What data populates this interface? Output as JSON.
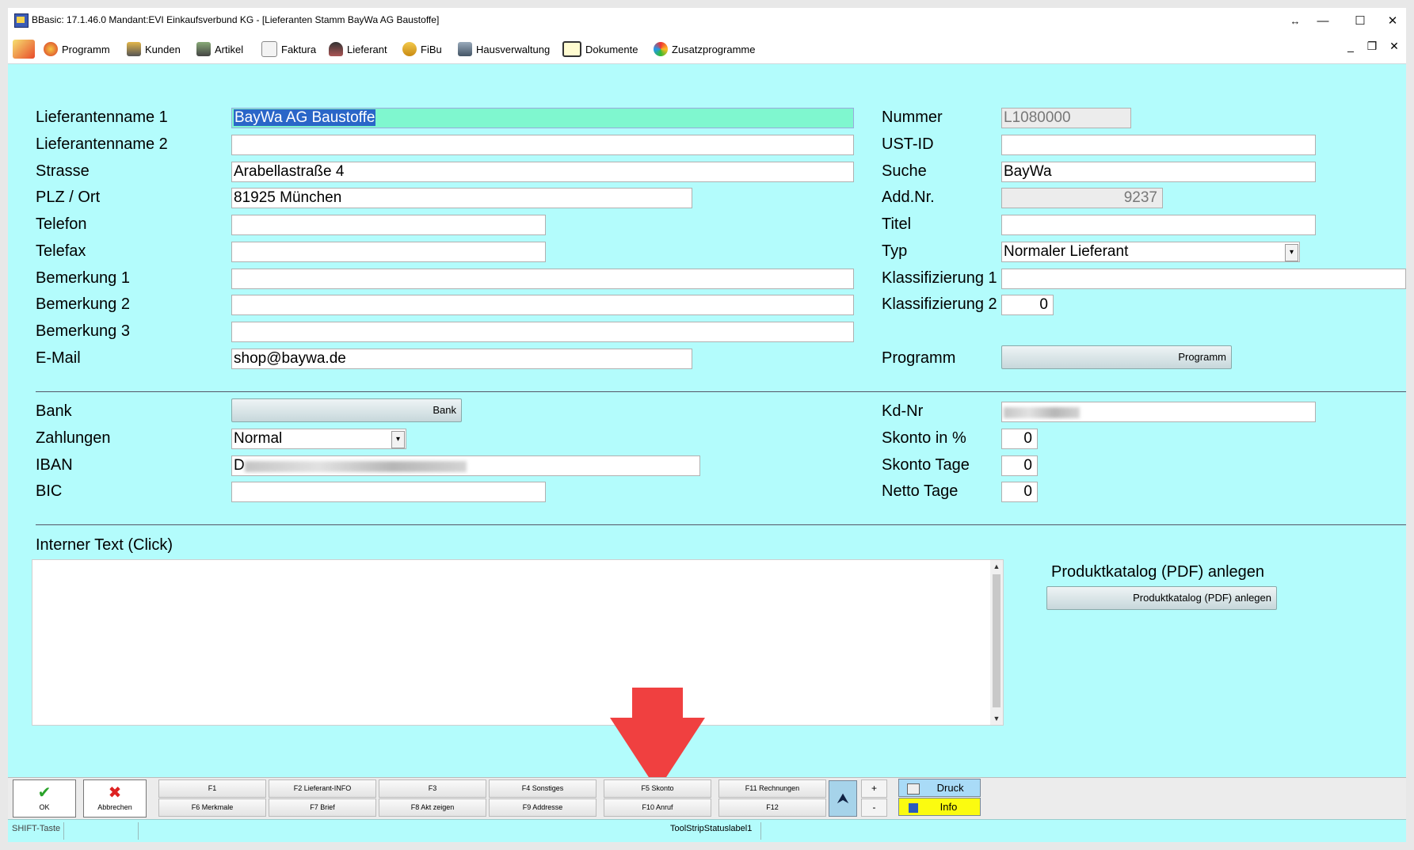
{
  "window": {
    "title": "BBasic: 17.1.46.0 Mandant:EVI Einkaufsverbund KG  - [Lieferanten Stamm BayWa AG Baustoffe]",
    "controls": {
      "resize": "↔",
      "minimize": "—",
      "maximize": "☐",
      "close": "✕"
    }
  },
  "menu": {
    "items": [
      {
        "label": "Programm",
        "icon": "program-icon"
      },
      {
        "label": "Kunden",
        "icon": "customers-icon"
      },
      {
        "label": "Artikel",
        "icon": "articles-icon"
      },
      {
        "label": "Faktura",
        "icon": "invoice-icon"
      },
      {
        "label": "Lieferant",
        "icon": "supplier-icon"
      },
      {
        "label": "FiBu",
        "icon": "accounting-icon"
      },
      {
        "label": "Hausverwaltung",
        "icon": "property-icon"
      },
      {
        "label": "Dokumente",
        "icon": "documents-icon"
      },
      {
        "label": "Zusatzprogramme",
        "icon": "addons-icon"
      }
    ],
    "mdi": {
      "minimize": "_",
      "restore": "❐",
      "close": "✕"
    }
  },
  "form": {
    "left": {
      "name1_label": "Lieferantenname 1",
      "name1": "BayWa AG Baustoffe",
      "name2_label": "Lieferantenname 2",
      "name2": "",
      "street_label": "Strasse",
      "street": "Arabellastraße 4",
      "zip_city_label": "PLZ / Ort",
      "zip_city": "81925 München",
      "phone_label": "Telefon",
      "phone": "",
      "fax_label": "Telefax",
      "fax": "",
      "note1_label": "Bemerkung 1",
      "note1": "",
      "note2_label": "Bemerkung 2",
      "note2": "",
      "note3_label": "Bemerkung 3",
      "note3": "",
      "email_label": "E-Mail",
      "email": "shop@baywa.de"
    },
    "right": {
      "number_label": "Nummer",
      "number": "L1080000",
      "vat_label": "UST-ID",
      "vat": "",
      "search_label": "Suche",
      "search": "BayWa",
      "addnr_label": "Add.Nr.",
      "addnr": "9237",
      "title_label": "Titel",
      "title": "",
      "type_label": "Typ",
      "type": "Normaler Lieferant",
      "class1_label": "Klassifizierung 1",
      "class1": "",
      "class2_label": "Klassifizierung 2",
      "class2": "0",
      "program_label": "Programm",
      "program_button": "Programm"
    },
    "bank": {
      "bank_label": "Bank",
      "bank_button": "Bank",
      "payments_label": "Zahlungen",
      "payments": "Normal",
      "iban_label": "IBAN",
      "iban_visible": "D",
      "bic_label": "BIC",
      "bic": ""
    },
    "terms": {
      "custnr_label": "Kd-Nr",
      "discount_pct_label": "Skonto in %",
      "discount_pct": "0",
      "discount_days_label": "Skonto Tage",
      "discount_days": "0",
      "net_days_label": "Netto Tage",
      "net_days": "0"
    },
    "internal_text_label": "Interner Text (Click)",
    "catalog_label": "Produktkatalog (PDF) anlegen",
    "catalog_button": "Produktkatalog (PDF) anlegen"
  },
  "bottombar": {
    "ok": "OK",
    "cancel": "Abbrechen",
    "fkeys_top": [
      "F1",
      "F2 Lieferant-INFO",
      "F3",
      "F4 Sonstiges",
      "F5 Skonto",
      "F11 Rechnungen"
    ],
    "fkeys_bottom": [
      "F6 Merkmale",
      "F7 Brief",
      "F8 Akt zeigen",
      "F9 Addresse",
      "F10 Anruf",
      "F12"
    ],
    "plus": "+",
    "minus": "-",
    "druck": "Druck",
    "info": "Info"
  },
  "status": {
    "shift": "SHIFT-Taste",
    "label": "ToolStripStatuslabel1"
  },
  "colors": {
    "form_bg": "#b3fcfc",
    "highlight_field": "#7ff7cf",
    "arrow": "#f04040",
    "info_bg": "#fbfb10",
    "druck_bg": "#a9dbf7"
  }
}
